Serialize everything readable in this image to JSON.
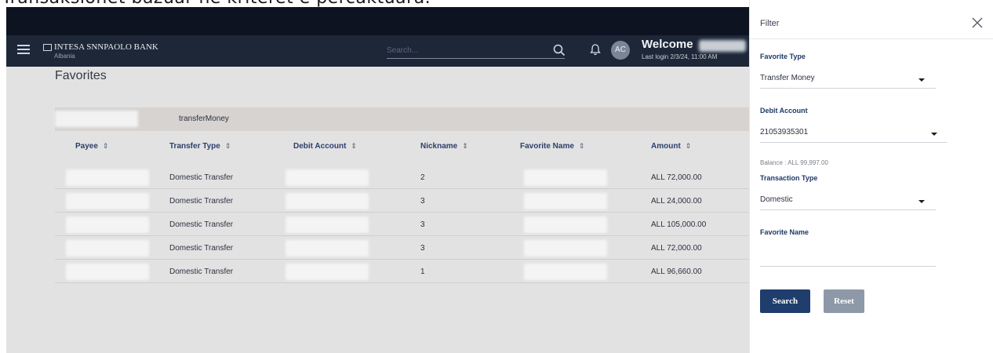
{
  "caption": "Transaksionet bazuar në kriteret e përcaktuara.",
  "header": {
    "bank_name": "INTESA SNNPAOLO BANK",
    "bank_country": "Albania",
    "search_placeholder": "Search...",
    "avatar_initials": "AC",
    "welcome": "Welcome",
    "last_login": "Last login 2/3/24, 11:00 AM"
  },
  "page": {
    "title": "Favorites"
  },
  "tabs": {
    "active_label": "transferMoney"
  },
  "table": {
    "columns": [
      "Payee",
      "Transfer Type",
      "Debit Account",
      "Nickname",
      "Favorite Name",
      "Amount"
    ],
    "rows": [
      {
        "transfer_type": "Domestic Transfer",
        "nickname": "2",
        "amount": "ALL 72,000.00"
      },
      {
        "transfer_type": "Domestic Transfer",
        "nickname": "3",
        "amount": "ALL 24,000.00"
      },
      {
        "transfer_type": "Domestic Transfer",
        "nickname": "3",
        "amount": "ALL 105,000.00"
      },
      {
        "transfer_type": "Domestic Transfer",
        "nickname": "3",
        "amount": "ALL 72,000.00"
      },
      {
        "transfer_type": "Domestic Transfer",
        "nickname": "1",
        "amount": "ALL 96,660.00"
      }
    ]
  },
  "filter": {
    "title": "Filter",
    "favorite_type_label": "Favorite Type",
    "favorite_type_value": "Transfer Money",
    "debit_account_label": "Debit Account",
    "debit_account_value": "21053935301",
    "balance": "Balance : ALL 99,997.00",
    "transaction_type_label": "Transaction Type",
    "transaction_type_value": "Domestic",
    "favorite_name_label": "Favorite Name",
    "favorite_name_value": "",
    "search_button": "Search",
    "reset_button": "Reset"
  },
  "colors": {
    "header_bg": "#1d2738",
    "top_strip_bg": "#0d1320",
    "primary_button": "#1f3e6d",
    "secondary_button": "#8e99a8",
    "label_blue": "#1f3a66",
    "overlay_gray": "#e2e2e2"
  },
  "icons": [
    "hamburger-icon",
    "logo-icon",
    "search-icon",
    "bell-icon",
    "sort-icon",
    "close-icon",
    "chevron-down-icon"
  ]
}
